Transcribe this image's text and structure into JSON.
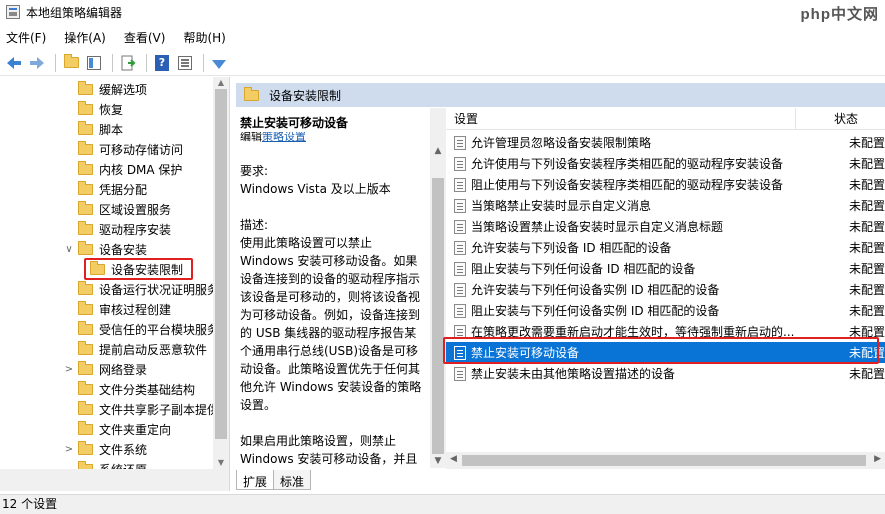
{
  "window": {
    "title": "本地组策略编辑器",
    "watermark": "php中文网"
  },
  "menu": [
    "文件(F)",
    "操作(A)",
    "查看(V)",
    "帮助(H)"
  ],
  "toolbar_icons": [
    "back-arrow-icon",
    "forward-arrow-icon",
    "folder-up-icon",
    "show-hide-tree-icon",
    "export-list-icon",
    "help-icon",
    "view-icon",
    "filter-icon"
  ],
  "tree": {
    "items": [
      {
        "label": "缓解选项",
        "arrow": "",
        "indent": 1
      },
      {
        "label": "恢复",
        "arrow": "",
        "indent": 1
      },
      {
        "label": "脚本",
        "arrow": "",
        "indent": 1
      },
      {
        "label": "可移动存储访问",
        "arrow": "",
        "indent": 1
      },
      {
        "label": "内核 DMA 保护",
        "arrow": "",
        "indent": 1
      },
      {
        "label": "凭据分配",
        "arrow": "",
        "indent": 1
      },
      {
        "label": "区域设置服务",
        "arrow": "",
        "indent": 1
      },
      {
        "label": "驱动程序安装",
        "arrow": "",
        "indent": 1
      },
      {
        "label": "设备安装",
        "arrow": "∨",
        "indent": 1
      },
      {
        "label": "设备安装限制",
        "arrow": "",
        "indent": 2,
        "selected": true
      },
      {
        "label": "设备运行状况证明服务",
        "arrow": "",
        "indent": 1
      },
      {
        "label": "审核过程创建",
        "arrow": "",
        "indent": 1
      },
      {
        "label": "受信任的平台模块服务",
        "arrow": "",
        "indent": 1
      },
      {
        "label": "提前启动反恶意软件",
        "arrow": "",
        "indent": 1
      },
      {
        "label": "网络登录",
        "arrow": ">",
        "indent": 1
      },
      {
        "label": "文件分类基础结构",
        "arrow": "",
        "indent": 1
      },
      {
        "label": "文件共享影子副本提供程序",
        "arrow": "",
        "indent": 1
      },
      {
        "label": "文件夹重定向",
        "arrow": "",
        "indent": 1
      },
      {
        "label": "文件系统",
        "arrow": ">",
        "indent": 1
      },
      {
        "label": "系统还原",
        "arrow": "",
        "indent": 1
      }
    ]
  },
  "right": {
    "header": "设备安装限制",
    "description": {
      "title": "禁止安装可移动设备",
      "edit_prefix": "编辑",
      "edit_link": "策略设置",
      "req_label": "要求:",
      "req_value": "Windows Vista 及以上版本",
      "desc_label": "描述:",
      "desc_text": "使用此策略设置可以禁止 Windows 安装可移动设备。如果设备连接到的设备的驱动程序指示该设备是可移动的，则将该设备视为可移动设备。例如，设备连接到的 USB 集线器的驱动程序报告某个通用串行总线(USB)设备是可移动设备。此策略设置优先于任何其他允许 Windows 安装设备的策略设置。",
      "desc_text2": "如果启用此策略设置，则禁止 Windows 安装可移动设备，并且不能更新现有可移动设备的驱动程序"
    },
    "list": {
      "col_setting": "设置",
      "col_state": "状态",
      "rows": [
        {
          "label": "允许管理员忽略设备安装限制策略",
          "state": "未配置"
        },
        {
          "label": "允许使用与下列设备安装程序类相匹配的驱动程序安装设备",
          "state": "未配置"
        },
        {
          "label": "阻止使用与下列设备安装程序类相匹配的驱动程序安装设备",
          "state": "未配置"
        },
        {
          "label": "当策略禁止安装时显示自定义消息",
          "state": "未配置"
        },
        {
          "label": "当策略设置禁止设备安装时显示自定义消息标题",
          "state": "未配置"
        },
        {
          "label": "允许安装与下列设备 ID 相匹配的设备",
          "state": "未配置"
        },
        {
          "label": "阻止安装与下列任何设备 ID 相匹配的设备",
          "state": "未配置"
        },
        {
          "label": "允许安装与下列任何设备实例 ID 相匹配的设备",
          "state": "未配置"
        },
        {
          "label": "阻止安装与下列任何设备实例 ID 相匹配的设备",
          "state": "未配置"
        },
        {
          "label": "在策略更改需要重新启动才能生效时，等待强制重新启动的...",
          "state": "未配置"
        },
        {
          "label": "禁止安装可移动设备",
          "state": "未配置",
          "selected": true
        },
        {
          "label": "禁止安装未由其他策略设置描述的设备",
          "state": "未配置"
        }
      ]
    },
    "tabs": [
      "扩展",
      "标准"
    ]
  },
  "status": "12 个设置",
  "colors": {
    "selection": "#0a74d6",
    "header_band": "#cfdced",
    "highlight_box": "#e02020"
  }
}
